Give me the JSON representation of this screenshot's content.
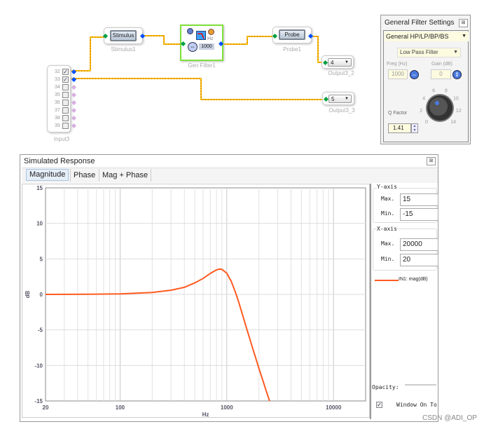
{
  "schematic": {
    "stimulus": {
      "button": "Stimulus",
      "label": "Stimulus1"
    },
    "filter": {
      "value": "1000",
      "unit": "Hz",
      "label": "Gen Filter1"
    },
    "probe": {
      "button": "Probe",
      "label": "Probe1"
    },
    "output2": {
      "value": "4",
      "label": "Output3_2"
    },
    "output3": {
      "value": "5",
      "label": "Output3_3"
    },
    "input": {
      "label": "Input3",
      "channels": [
        {
          "n": "32",
          "checked": true
        },
        {
          "n": "33",
          "checked": true
        },
        {
          "n": "34",
          "checked": false
        },
        {
          "n": "35",
          "checked": false
        },
        {
          "n": "36",
          "checked": false
        },
        {
          "n": "37",
          "checked": false
        },
        {
          "n": "38",
          "checked": false
        },
        {
          "n": "39",
          "checked": false
        }
      ]
    }
  },
  "filter_settings": {
    "title": "General Filter Settings",
    "close": "⊠",
    "type": "General HP/LP/BP/BS",
    "subtype": "Low Pass Filter",
    "freq_label": "Freq (Hz)",
    "freq": "1000",
    "gain_label": "Gain (dB)",
    "gain": "0",
    "q_label": "Q Factor",
    "q": "1.41",
    "knob_ticks": [
      "0",
      "2",
      "4",
      "6",
      "8",
      "10",
      "12",
      "14"
    ]
  },
  "response": {
    "title": "Simulated Response",
    "close": "⊠",
    "tabs": [
      {
        "label": "Magnitude",
        "active": true
      },
      {
        "label": "Phase"
      },
      {
        "label": "Mag + Phase"
      }
    ],
    "yaxis": {
      "title": "Y-axis",
      "max_label": "Max.",
      "max": "15",
      "min_label": "Min.",
      "min": "-15"
    },
    "xaxis": {
      "title": "X-axis",
      "max_label": "Max.",
      "max": "20000",
      "min_label": "Min.",
      "min": "20"
    },
    "legend": "IN1: mag(dB)",
    "opacity_label": "Opacity:",
    "window_on_top": "Window On To",
    "window_on_top_checked": true
  },
  "chart_data": {
    "type": "line",
    "xscale": "log",
    "xlabel": "Hz",
    "ylabel": "dB",
    "xlim": [
      20,
      20000
    ],
    "ylim": [
      -15,
      15
    ],
    "xticks": [
      "20",
      "100",
      "1000",
      "10000"
    ],
    "yticks": [
      "15",
      "10",
      "5",
      "0",
      "-5",
      "-10",
      "-15"
    ],
    "grid": true,
    "line_color": "#ff5a1f",
    "series": [
      {
        "name": "IN1: mag(dB)",
        "x": [
          20,
          50,
          100,
          200,
          300,
          400,
          500,
          600,
          700,
          800,
          850,
          900,
          1000,
          1100,
          1200,
          1300,
          1500,
          1750,
          2000,
          2250,
          2500,
          2600
        ],
        "y": [
          0.0,
          0.02,
          0.07,
          0.28,
          0.59,
          1.0,
          1.62,
          2.25,
          2.95,
          3.45,
          3.56,
          3.53,
          2.98,
          1.85,
          0.37,
          -1.2,
          -4.3,
          -7.6,
          -10.42,
          -12.8,
          -14.87,
          -15.6
        ]
      }
    ]
  },
  "watermark": "CSDN @ADI_OP"
}
